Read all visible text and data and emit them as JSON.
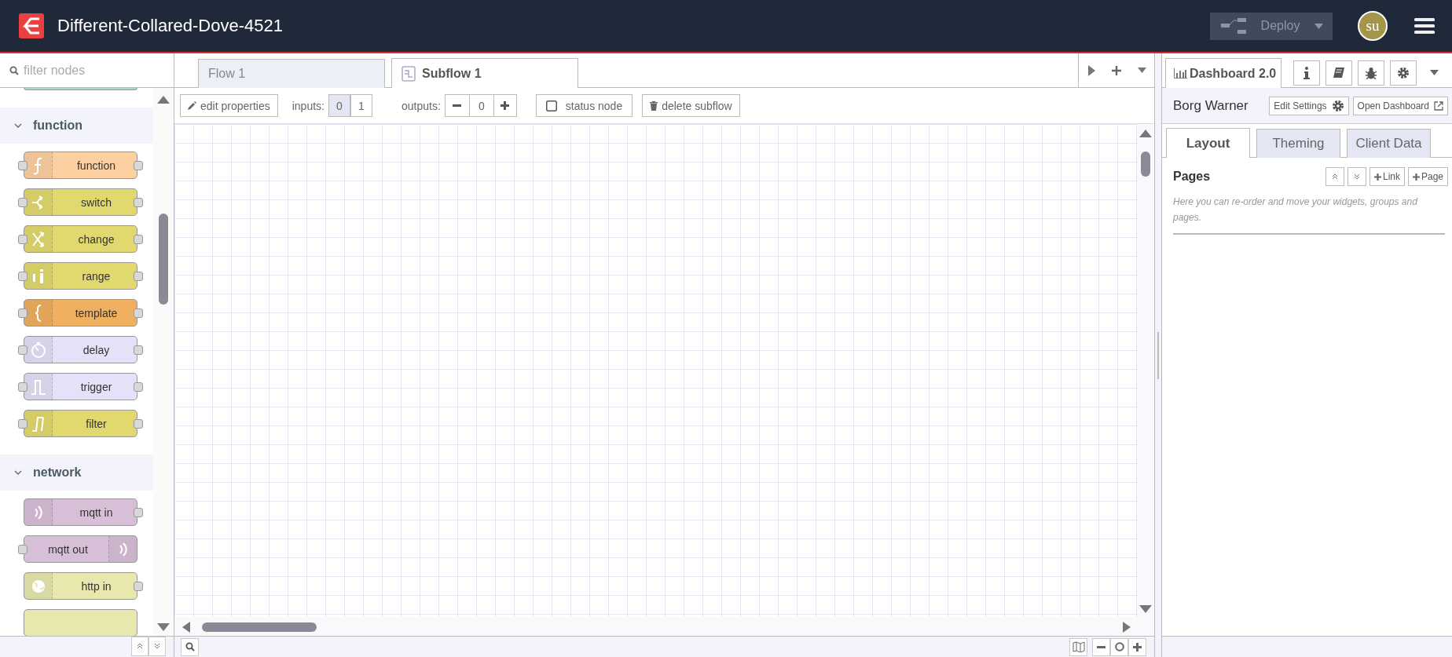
{
  "header": {
    "title": "Different-Collared-Dove-4521",
    "deploy": {
      "label": "Deploy",
      "disabled": true
    },
    "avatar": "su"
  },
  "palette": {
    "filter": {
      "placeholder": "filter nodes"
    },
    "clipped_node": {
      "color": "#a6d8d0"
    },
    "categories": [
      {
        "name": "function",
        "expanded": true,
        "nodes": [
          {
            "kind": "function",
            "label": "function",
            "color": "#fdd0a2",
            "input": true,
            "output": true,
            "icon_right": false
          },
          {
            "kind": "switch",
            "label": "switch",
            "color": "#e2d96e",
            "input": true,
            "output": true,
            "icon_right": false
          },
          {
            "kind": "change",
            "label": "change",
            "color": "#e2d96e",
            "input": true,
            "output": true,
            "icon_right": false
          },
          {
            "kind": "range",
            "label": "range",
            "color": "#e2d96e",
            "input": true,
            "output": true,
            "icon_right": false
          },
          {
            "kind": "template",
            "label": "template",
            "color": "#f0b060",
            "input": true,
            "output": true,
            "icon_right": false
          },
          {
            "kind": "delay",
            "label": "delay",
            "color": "#e6e0f8",
            "input": true,
            "output": true,
            "icon_right": false
          },
          {
            "kind": "trigger",
            "label": "trigger",
            "color": "#e6e0f8",
            "input": true,
            "output": true,
            "icon_right": false
          },
          {
            "kind": "filter",
            "label": "filter",
            "color": "#e2d96e",
            "input": true,
            "output": true,
            "icon_right": false
          }
        ]
      },
      {
        "name": "network",
        "expanded": true,
        "nodes": [
          {
            "kind": "mqtt",
            "label": "mqtt in",
            "color": "#d8bfd8",
            "input": false,
            "output": true,
            "icon_right": false
          },
          {
            "kind": "mqtt",
            "label": "mqtt out",
            "color": "#d8bfd8",
            "input": true,
            "output": false,
            "icon_right": true
          },
          {
            "kind": "globe",
            "label": "http in",
            "color": "#e7e7ae",
            "input": false,
            "output": true,
            "icon_right": false
          },
          {
            "kind": "partial",
            "color": "#e7e7ae"
          }
        ]
      }
    ]
  },
  "workspace": {
    "tabs": [
      {
        "label": "Flow 1",
        "kind": "flow",
        "selected": false
      },
      {
        "label": "Subflow 1",
        "kind": "subflow",
        "selected": true
      }
    ],
    "toolbar": {
      "edit": "edit properties",
      "inputs_label": "inputs:",
      "inputs": [
        {
          "label": "0",
          "selected": true
        },
        {
          "label": "1",
          "selected": false
        }
      ],
      "outputs_label": "outputs:",
      "outputs_value": "0",
      "status": {
        "label": "status node",
        "checked": false
      },
      "delete": "delete subflow"
    }
  },
  "sidebar": {
    "tabs": [
      {
        "label": "Dashboard 2.0",
        "kind": "dashboard",
        "selected": true
      },
      {
        "kind": "info",
        "selected": false
      },
      {
        "kind": "help",
        "selected": false
      },
      {
        "kind": "debug",
        "selected": false
      },
      {
        "kind": "config",
        "selected": false
      }
    ],
    "dashboard": {
      "name": "Borg Warner",
      "edit": "Edit Settings",
      "open": "Open Dashboard",
      "tabs": [
        {
          "label": "Layout",
          "selected": true
        },
        {
          "label": "Theming",
          "selected": false
        },
        {
          "label": "Client Data",
          "selected": false
        }
      ],
      "pages_title": "Pages",
      "link": "Link",
      "page": "Page",
      "hint": "Here you can re-order and move your widgets, groups and pages."
    }
  }
}
